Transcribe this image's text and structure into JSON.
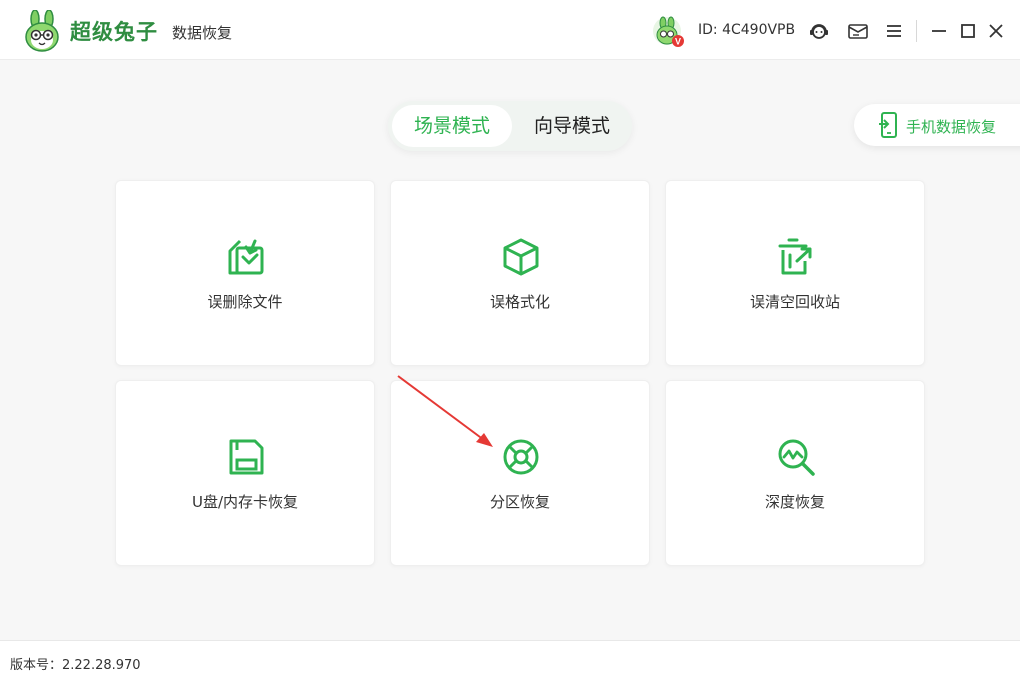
{
  "app": {
    "brand_name": "超级兔子",
    "brand_sub": "数据恢复"
  },
  "header": {
    "user_id": "ID: 4C490VPB",
    "avatar_badge": "V",
    "icons": [
      "support-icon",
      "message-icon",
      "menu-icon",
      "minimize-icon",
      "maximize-icon",
      "close-icon"
    ]
  },
  "modes": {
    "scene": "场景模式",
    "wizard": "向导模式",
    "active": "scene"
  },
  "mobile_recovery": {
    "label": "手机数据恢复"
  },
  "cards": [
    {
      "label": "误删除文件",
      "icon": "file-download-icon"
    },
    {
      "label": "误格式化",
      "icon": "cube-icon"
    },
    {
      "label": "误清空回收站",
      "icon": "trash-icon"
    },
    {
      "label": "U盘/内存卡恢复",
      "icon": "sd-card-icon"
    },
    {
      "label": "分区恢复",
      "icon": "partition-icon"
    },
    {
      "label": "深度恢复",
      "icon": "deep-search-icon"
    }
  ],
  "footer": {
    "version": "版本号：2.22.28.970"
  },
  "colors": {
    "accent": "#2fb351",
    "brand": "#2f8d41",
    "annotation": "#e53935"
  }
}
